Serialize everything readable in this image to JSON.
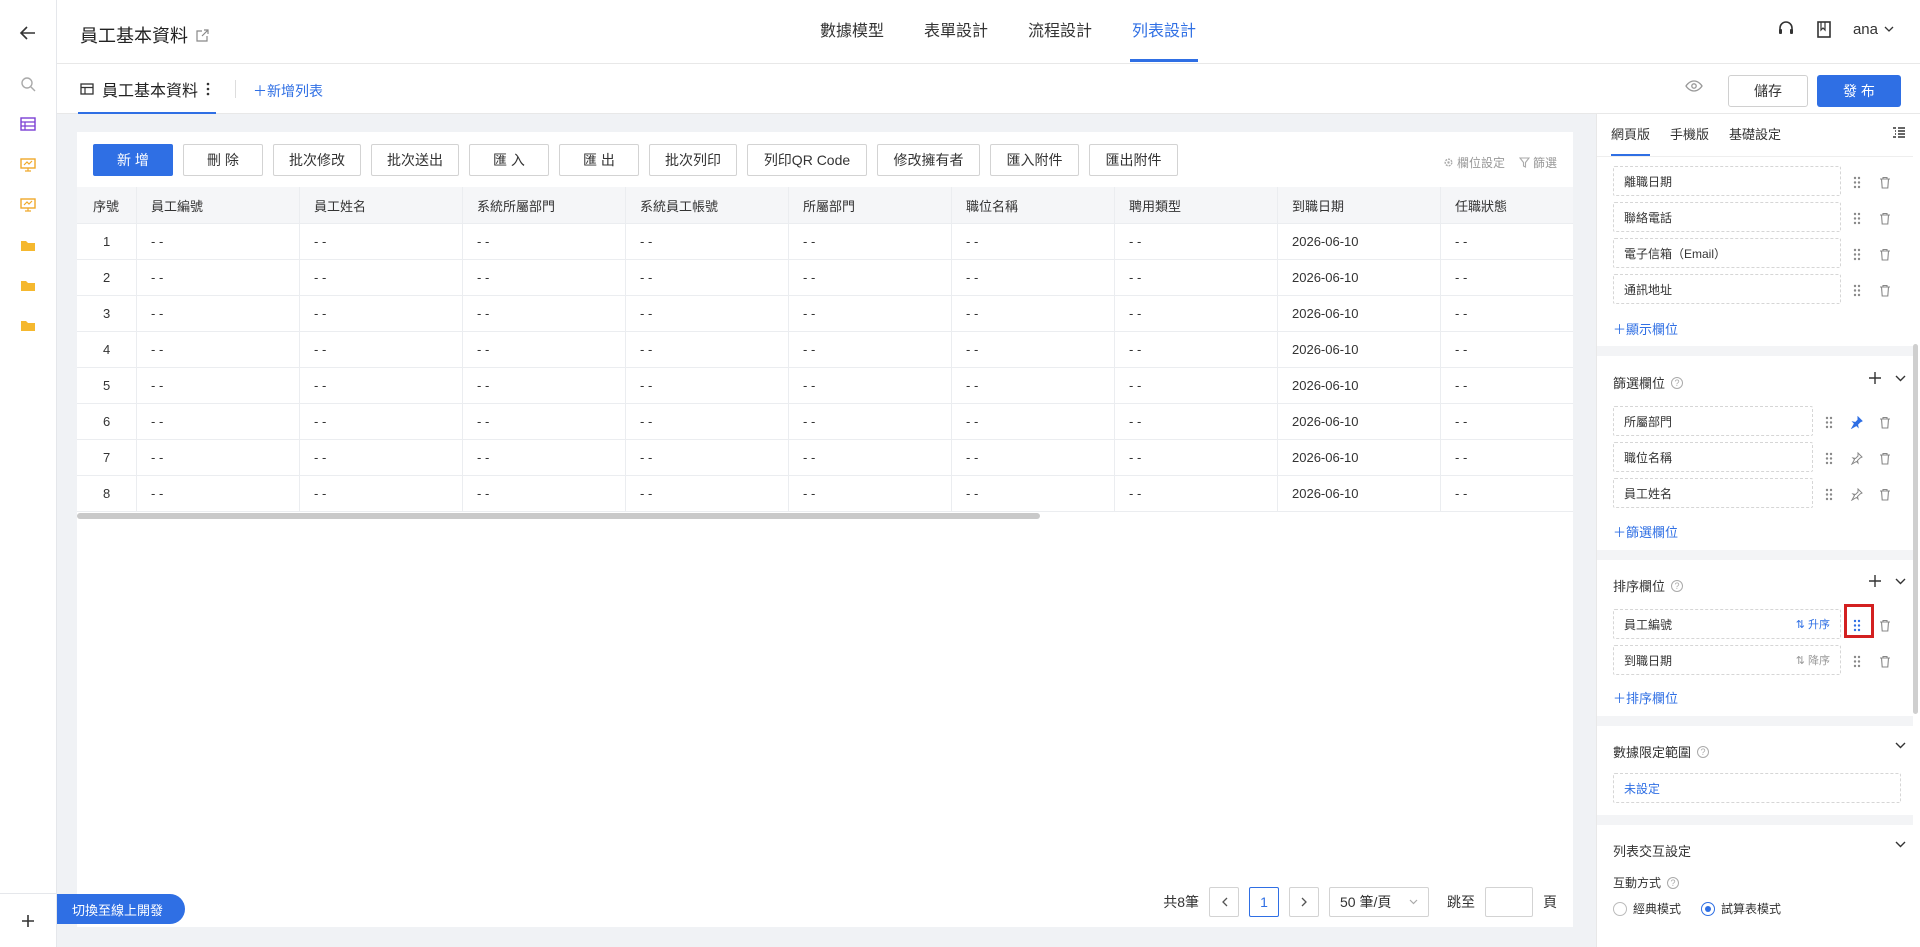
{
  "header": {
    "title": "員工基本資料",
    "nav_tabs": [
      "數據模型",
      "表單設計",
      "流程設計",
      "列表設計"
    ],
    "user": "ana"
  },
  "subbar": {
    "list_tab": "員工基本資料",
    "add_list": "新增列表",
    "save": "儲存",
    "publish": "發 布"
  },
  "toolbar": {
    "buttons": [
      "新 增",
      "刪 除",
      "批次修改",
      "批次送出",
      "匯 入",
      "匯 出",
      "批次列印",
      "列印QR Code",
      "修改擁有者",
      "匯入附件",
      "匯出附件"
    ],
    "field_settings": "欄位設定",
    "filter": "篩選"
  },
  "table": {
    "columns": [
      "序號",
      "員工編號",
      "員工姓名",
      "系統所屬部門",
      "系統員工帳號",
      "所屬部門",
      "職位名稱",
      "聘用類型",
      "到職日期",
      "任職狀態"
    ],
    "rows": [
      [
        "1",
        "- -",
        "- -",
        "- -",
        "- -",
        "- -",
        "- -",
        "- -",
        "2026-06-10",
        "- -"
      ],
      [
        "2",
        "- -",
        "- -",
        "- -",
        "- -",
        "- -",
        "- -",
        "- -",
        "2026-06-10",
        "- -"
      ],
      [
        "3",
        "- -",
        "- -",
        "- -",
        "- -",
        "- -",
        "- -",
        "- -",
        "2026-06-10",
        "- -"
      ],
      [
        "4",
        "- -",
        "- -",
        "- -",
        "- -",
        "- -",
        "- -",
        "- -",
        "2026-06-10",
        "- -"
      ],
      [
        "5",
        "- -",
        "- -",
        "- -",
        "- -",
        "- -",
        "- -",
        "- -",
        "2026-06-10",
        "- -"
      ],
      [
        "6",
        "- -",
        "- -",
        "- -",
        "- -",
        "- -",
        "- -",
        "- -",
        "2026-06-10",
        "- -"
      ],
      [
        "7",
        "- -",
        "- -",
        "- -",
        "- -",
        "- -",
        "- -",
        "- -",
        "2026-06-10",
        "- -"
      ],
      [
        "8",
        "- -",
        "- -",
        "- -",
        "- -",
        "- -",
        "- -",
        "- -",
        "2026-06-10",
        "- -"
      ]
    ]
  },
  "pager": {
    "total": "共8筆",
    "current_page": "1",
    "page_size": "50 筆/頁",
    "jump_label": "跳至",
    "page_unit": "頁"
  },
  "switch_button": "切換至線上開發",
  "right_panel": {
    "tabs": [
      "網頁版",
      "手機版",
      "基礎設定"
    ],
    "display_fields": [
      "離職日期",
      "聯絡電話",
      "電子信箱（Email）",
      "通訊地址"
    ],
    "add_display_field": "顯示欄位",
    "filter_section": {
      "title": "篩選欄位",
      "fields": [
        "所屬部門",
        "職位名稱",
        "員工姓名"
      ],
      "add_label": "篩選欄位"
    },
    "sort_section": {
      "title": "排序欄位",
      "fields": [
        {
          "name": "員工編號",
          "order": "升序"
        },
        {
          "name": "到職日期",
          "order": "降序"
        }
      ],
      "add_label": "排序欄位"
    },
    "data_scope": {
      "title": "數據限定範圍",
      "value": "未設定"
    },
    "interaction": {
      "title": "列表交互設定",
      "mode_label": "互動方式",
      "options": [
        "經典模式",
        "試算表模式"
      ],
      "selected": "試算表模式"
    }
  },
  "colors": {
    "accent": "#2f6fe4",
    "highlight": "#d32020"
  }
}
